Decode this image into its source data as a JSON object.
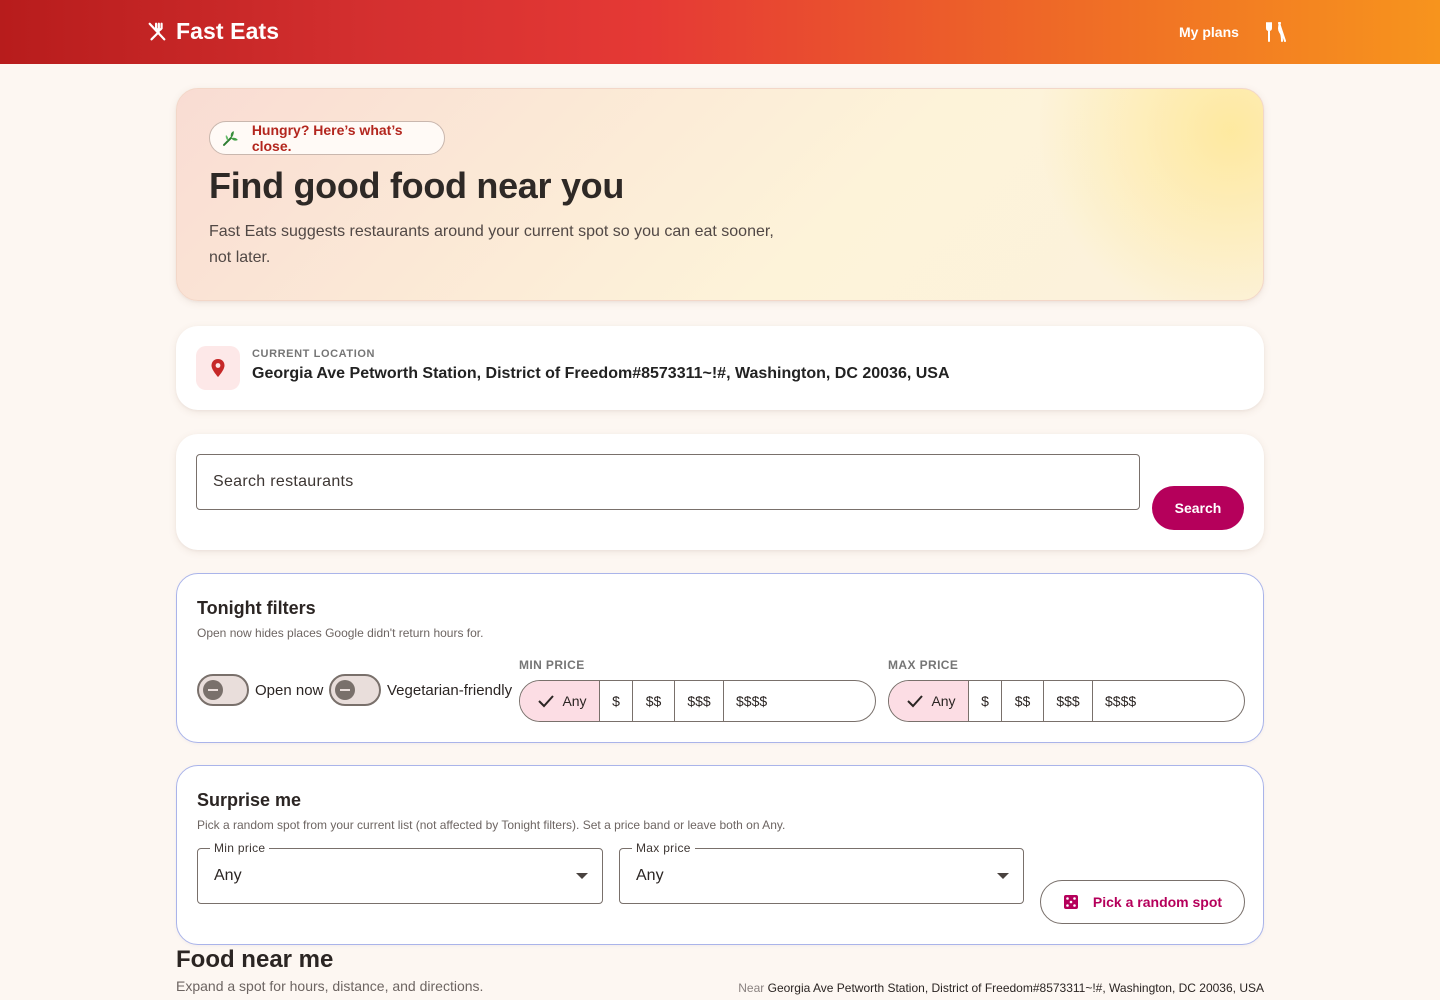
{
  "app": {
    "name": "Fast Eats"
  },
  "nav": {
    "plans_label": "My plans"
  },
  "hero": {
    "chip": "Hungry? Here’s what’s close.",
    "title": "Find good food near you",
    "subtitle": "Fast Eats suggests restaurants around your current spot so you can eat sooner, not later."
  },
  "location": {
    "label": "CURRENT LOCATION",
    "value": "Georgia Ave Petworth Station, District of Freedom#8573311~!#, Washington, DC 20036, USA"
  },
  "search": {
    "placeholder": "Search restaurants",
    "button": "Search"
  },
  "filters": {
    "title": "Tonight filters",
    "subtitle": "Open now hides places Google didn't return hours for.",
    "open_now": "Open now",
    "vegetarian": "Vegetarian-friendly",
    "min_price_label": "MIN PRICE",
    "max_price_label": "MAX PRICE",
    "price_options": [
      "Any",
      "$",
      "$$",
      "$$$",
      "$$$$"
    ]
  },
  "surprise": {
    "title": "Surprise me",
    "subtitle": "Pick a random spot from your current list (not affected by Tonight filters). Set a price band or leave both on Any.",
    "min_label": "Min price",
    "min_value": "Any",
    "max_label": "Max price",
    "max_value": "Any",
    "button": "Pick a random spot"
  },
  "near": {
    "title": "Food near me",
    "subtitle": "Expand a spot for hours, distance, and directions.",
    "near_label": "Near",
    "near_value": "Georgia Ave Petworth Station, District of Freedom#8573311~!#, Washington, DC 20036, USA"
  },
  "colors": {
    "accent": "#b5005b",
    "brand_start": "#b71c1c",
    "brand_end": "#f7941d",
    "pin": "#c62828"
  },
  "icons": {
    "brand": "fork-knife-icon",
    "nav": "utensils-icon",
    "chip": "sprout-icon",
    "location": "location-pin-icon",
    "random": "dice-icon"
  }
}
